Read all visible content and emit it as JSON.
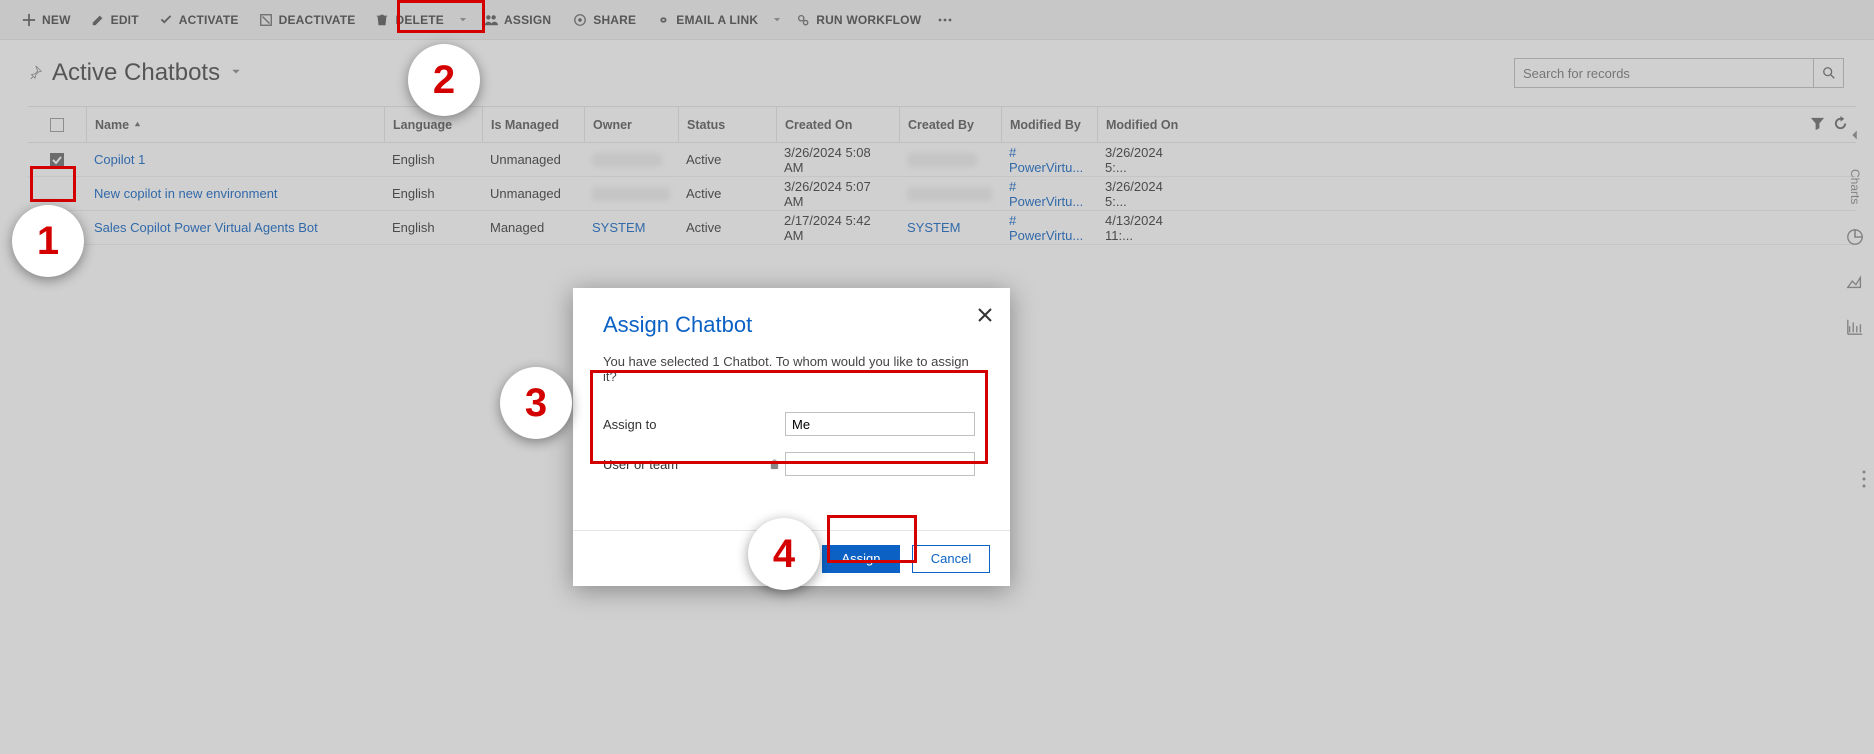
{
  "toolbar": {
    "new": "NEW",
    "edit": "EDIT",
    "activate": "ACTIVATE",
    "deactivate": "DEACTIVATE",
    "delete": "DELETE",
    "assign": "ASSIGN",
    "share": "SHARE",
    "email_link": "EMAIL A LINK",
    "run_workflow": "RUN WORKFLOW"
  },
  "view": {
    "title": "Active Chatbots",
    "search_placeholder": "Search for records"
  },
  "columns": {
    "name": "Name",
    "language": "Language",
    "is_managed": "Is Managed",
    "owner": "Owner",
    "status": "Status",
    "created_on": "Created On",
    "created_by": "Created By",
    "modified_by": "Modified By",
    "modified_on": "Modified On"
  },
  "rows": [
    {
      "name": "Copilot 1",
      "language": "English",
      "is_managed": "Unmanaged",
      "owner": "",
      "status": "Active",
      "created_on": "3/26/2024 5:08 AM",
      "created_by": "",
      "modified_by": "# PowerVirtu...",
      "modified_on": "3/26/2024 5:..."
    },
    {
      "name": "New copilot in new environment",
      "language": "English",
      "is_managed": "Unmanaged",
      "owner": "",
      "status": "Active",
      "created_on": "3/26/2024 5:07 AM",
      "created_by": "",
      "modified_by": "# PowerVirtu...",
      "modified_on": "3/26/2024 5:..."
    },
    {
      "name": "Sales Copilot Power Virtual Agents Bot",
      "language": "English",
      "is_managed": "Managed",
      "owner": "SYSTEM",
      "status": "Active",
      "created_on": "2/17/2024 5:42 AM",
      "created_by": "SYSTEM",
      "modified_by": "# PowerVirtu...",
      "modified_on": "4/13/2024 11:..."
    }
  ],
  "dialog": {
    "title": "Assign Chatbot",
    "message": "You have selected 1 Chatbot. To whom would you like to assign it?",
    "assign_to_label": "Assign to",
    "assign_to_value": "Me",
    "user_or_team_label": "User or team",
    "user_or_team_value": "",
    "assign_btn": "Assign",
    "cancel_btn": "Cancel"
  },
  "rail": {
    "charts": "Charts"
  },
  "callouts": {
    "c1": "1",
    "c2": "2",
    "c3": "3",
    "c4": "4"
  }
}
